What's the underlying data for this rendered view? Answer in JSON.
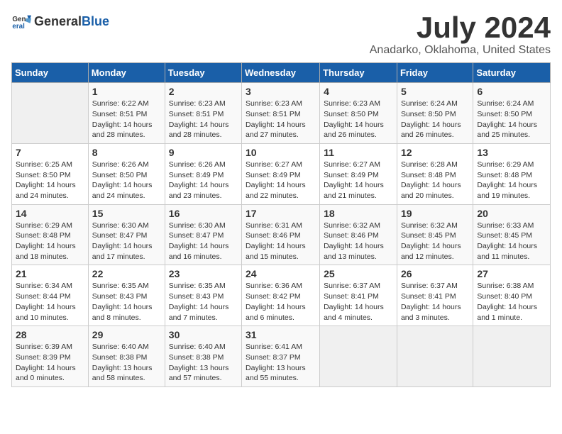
{
  "logo": {
    "general": "General",
    "blue": "Blue"
  },
  "header": {
    "title": "July 2024",
    "subtitle": "Anadarko, Oklahoma, United States"
  },
  "days_of_week": [
    "Sunday",
    "Monday",
    "Tuesday",
    "Wednesday",
    "Thursday",
    "Friday",
    "Saturday"
  ],
  "weeks": [
    [
      {
        "day": "",
        "detail": ""
      },
      {
        "day": "1",
        "detail": "Sunrise: 6:22 AM\nSunset: 8:51 PM\nDaylight: 14 hours\nand 28 minutes."
      },
      {
        "day": "2",
        "detail": "Sunrise: 6:23 AM\nSunset: 8:51 PM\nDaylight: 14 hours\nand 28 minutes."
      },
      {
        "day": "3",
        "detail": "Sunrise: 6:23 AM\nSunset: 8:51 PM\nDaylight: 14 hours\nand 27 minutes."
      },
      {
        "day": "4",
        "detail": "Sunrise: 6:23 AM\nSunset: 8:50 PM\nDaylight: 14 hours\nand 26 minutes."
      },
      {
        "day": "5",
        "detail": "Sunrise: 6:24 AM\nSunset: 8:50 PM\nDaylight: 14 hours\nand 26 minutes."
      },
      {
        "day": "6",
        "detail": "Sunrise: 6:24 AM\nSunset: 8:50 PM\nDaylight: 14 hours\nand 25 minutes."
      }
    ],
    [
      {
        "day": "7",
        "detail": "Sunrise: 6:25 AM\nSunset: 8:50 PM\nDaylight: 14 hours\nand 24 minutes."
      },
      {
        "day": "8",
        "detail": "Sunrise: 6:26 AM\nSunset: 8:50 PM\nDaylight: 14 hours\nand 24 minutes."
      },
      {
        "day": "9",
        "detail": "Sunrise: 6:26 AM\nSunset: 8:49 PM\nDaylight: 14 hours\nand 23 minutes."
      },
      {
        "day": "10",
        "detail": "Sunrise: 6:27 AM\nSunset: 8:49 PM\nDaylight: 14 hours\nand 22 minutes."
      },
      {
        "day": "11",
        "detail": "Sunrise: 6:27 AM\nSunset: 8:49 PM\nDaylight: 14 hours\nand 21 minutes."
      },
      {
        "day": "12",
        "detail": "Sunrise: 6:28 AM\nSunset: 8:48 PM\nDaylight: 14 hours\nand 20 minutes."
      },
      {
        "day": "13",
        "detail": "Sunrise: 6:29 AM\nSunset: 8:48 PM\nDaylight: 14 hours\nand 19 minutes."
      }
    ],
    [
      {
        "day": "14",
        "detail": "Sunrise: 6:29 AM\nSunset: 8:48 PM\nDaylight: 14 hours\nand 18 minutes."
      },
      {
        "day": "15",
        "detail": "Sunrise: 6:30 AM\nSunset: 8:47 PM\nDaylight: 14 hours\nand 17 minutes."
      },
      {
        "day": "16",
        "detail": "Sunrise: 6:30 AM\nSunset: 8:47 PM\nDaylight: 14 hours\nand 16 minutes."
      },
      {
        "day": "17",
        "detail": "Sunrise: 6:31 AM\nSunset: 8:46 PM\nDaylight: 14 hours\nand 15 minutes."
      },
      {
        "day": "18",
        "detail": "Sunrise: 6:32 AM\nSunset: 8:46 PM\nDaylight: 14 hours\nand 13 minutes."
      },
      {
        "day": "19",
        "detail": "Sunrise: 6:32 AM\nSunset: 8:45 PM\nDaylight: 14 hours\nand 12 minutes."
      },
      {
        "day": "20",
        "detail": "Sunrise: 6:33 AM\nSunset: 8:45 PM\nDaylight: 14 hours\nand 11 minutes."
      }
    ],
    [
      {
        "day": "21",
        "detail": "Sunrise: 6:34 AM\nSunset: 8:44 PM\nDaylight: 14 hours\nand 10 minutes."
      },
      {
        "day": "22",
        "detail": "Sunrise: 6:35 AM\nSunset: 8:43 PM\nDaylight: 14 hours\nand 8 minutes."
      },
      {
        "day": "23",
        "detail": "Sunrise: 6:35 AM\nSunset: 8:43 PM\nDaylight: 14 hours\nand 7 minutes."
      },
      {
        "day": "24",
        "detail": "Sunrise: 6:36 AM\nSunset: 8:42 PM\nDaylight: 14 hours\nand 6 minutes."
      },
      {
        "day": "25",
        "detail": "Sunrise: 6:37 AM\nSunset: 8:41 PM\nDaylight: 14 hours\nand 4 minutes."
      },
      {
        "day": "26",
        "detail": "Sunrise: 6:37 AM\nSunset: 8:41 PM\nDaylight: 14 hours\nand 3 minutes."
      },
      {
        "day": "27",
        "detail": "Sunrise: 6:38 AM\nSunset: 8:40 PM\nDaylight: 14 hours\nand 1 minute."
      }
    ],
    [
      {
        "day": "28",
        "detail": "Sunrise: 6:39 AM\nSunset: 8:39 PM\nDaylight: 14 hours\nand 0 minutes."
      },
      {
        "day": "29",
        "detail": "Sunrise: 6:40 AM\nSunset: 8:38 PM\nDaylight: 13 hours\nand 58 minutes."
      },
      {
        "day": "30",
        "detail": "Sunrise: 6:40 AM\nSunset: 8:38 PM\nDaylight: 13 hours\nand 57 minutes."
      },
      {
        "day": "31",
        "detail": "Sunrise: 6:41 AM\nSunset: 8:37 PM\nDaylight: 13 hours\nand 55 minutes."
      },
      {
        "day": "",
        "detail": ""
      },
      {
        "day": "",
        "detail": ""
      },
      {
        "day": "",
        "detail": ""
      }
    ]
  ]
}
